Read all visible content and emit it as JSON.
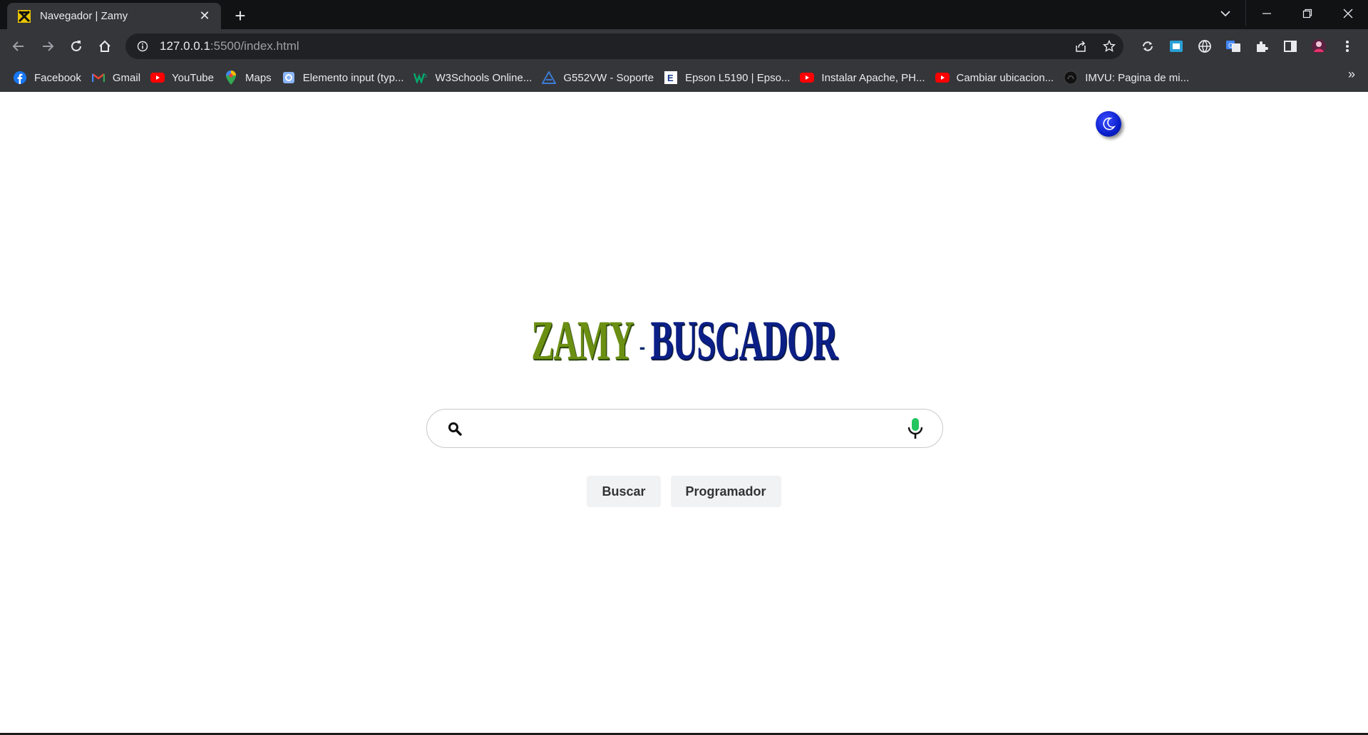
{
  "browser": {
    "tab": {
      "title": "Navegador | Zamy",
      "close_label": "✕"
    },
    "new_tab_label": "+",
    "url": {
      "host": "127.0.0.1",
      "path": ":5500/index.html"
    },
    "bookmarks": [
      {
        "label": "Facebook",
        "icon": "facebook-icon",
        "color": "#1877f2"
      },
      {
        "label": "Gmail",
        "icon": "gmail-icon",
        "color": "#ea4335"
      },
      {
        "label": "YouTube",
        "icon": "youtube-icon",
        "color": "#ff0000"
      },
      {
        "label": "Maps",
        "icon": "maps-icon",
        "color": "#34a853"
      },
      {
        "label": "Elemento input (typ...",
        "icon": "page-icon",
        "color": "#8ab4f8"
      },
      {
        "label": "W3Schools Online...",
        "icon": "w3schools-icon",
        "color": "#04aa6d"
      },
      {
        "label": "G552VW - Soporte",
        "icon": "asus-icon",
        "color": "#3b7bd4"
      },
      {
        "label": "Epson L5190 | Epso...",
        "icon": "epson-icon",
        "color": "#ffffff"
      },
      {
        "label": "Instalar Apache, PH...",
        "icon": "youtube-icon",
        "color": "#ff0000"
      },
      {
        "label": "Cambiar ubicacion...",
        "icon": "youtube-icon",
        "color": "#ff0000"
      },
      {
        "label": "IMVU: Pagina de mi...",
        "icon": "imvu-icon",
        "color": "#222222"
      }
    ],
    "bookmarks_more": "»"
  },
  "page": {
    "logo": {
      "part1": "ZAMY",
      "separator": "-",
      "part2": "BUSCADOR"
    },
    "search": {
      "value": "",
      "placeholder": ""
    },
    "buttons": {
      "search_label": "Buscar",
      "programmer_label": "Programador"
    }
  },
  "colors": {
    "logo_green": "#6b8f12",
    "logo_blue": "#0b1f86",
    "toggle_blue": "#0a1fcc",
    "mic_green": "#22c55e"
  }
}
